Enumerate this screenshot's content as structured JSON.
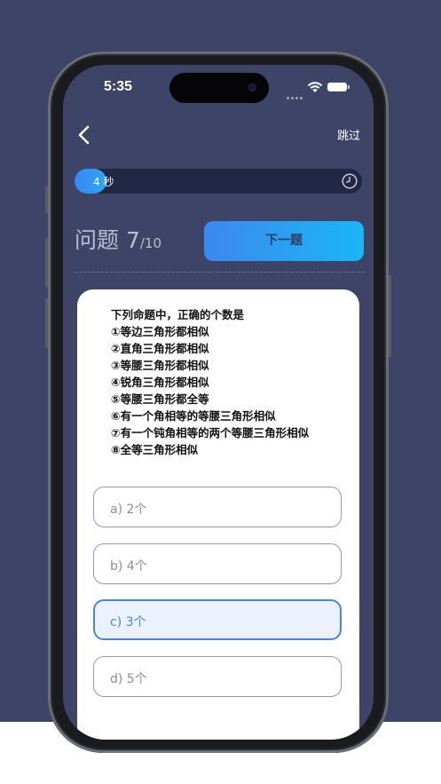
{
  "status_bar": {
    "time": "5:35"
  },
  "header": {
    "skip_label": "跳过"
  },
  "timer": {
    "text": "4 秒",
    "progress": 0.11
  },
  "question_counter": {
    "prefix": "问题 ",
    "current": "7",
    "total": "/10"
  },
  "next_button": {
    "label": "下一题"
  },
  "question": {
    "lines": [
      "下列命题中，正确的个数是",
      "①等边三角形都相似",
      "②直角三角形都相似",
      "③等腰三角形都相似",
      "④锐角三角形都相似",
      "⑤等腰三角形都全等",
      "⑥有一个角相等的等腰三角形相似",
      "⑦有一个钝角相等的两个等腰三角形相似",
      "⑧全等三角形相似"
    ]
  },
  "options": [
    {
      "label": "a) 2个",
      "selected": false
    },
    {
      "label": "b) 4个",
      "selected": false
    },
    {
      "label": "c) 3个",
      "selected": true
    },
    {
      "label": "d) 5个",
      "selected": false
    }
  ],
  "colors": {
    "background": "#3d4468",
    "accent": "#3d88ee",
    "selected": "#4a86d6"
  }
}
